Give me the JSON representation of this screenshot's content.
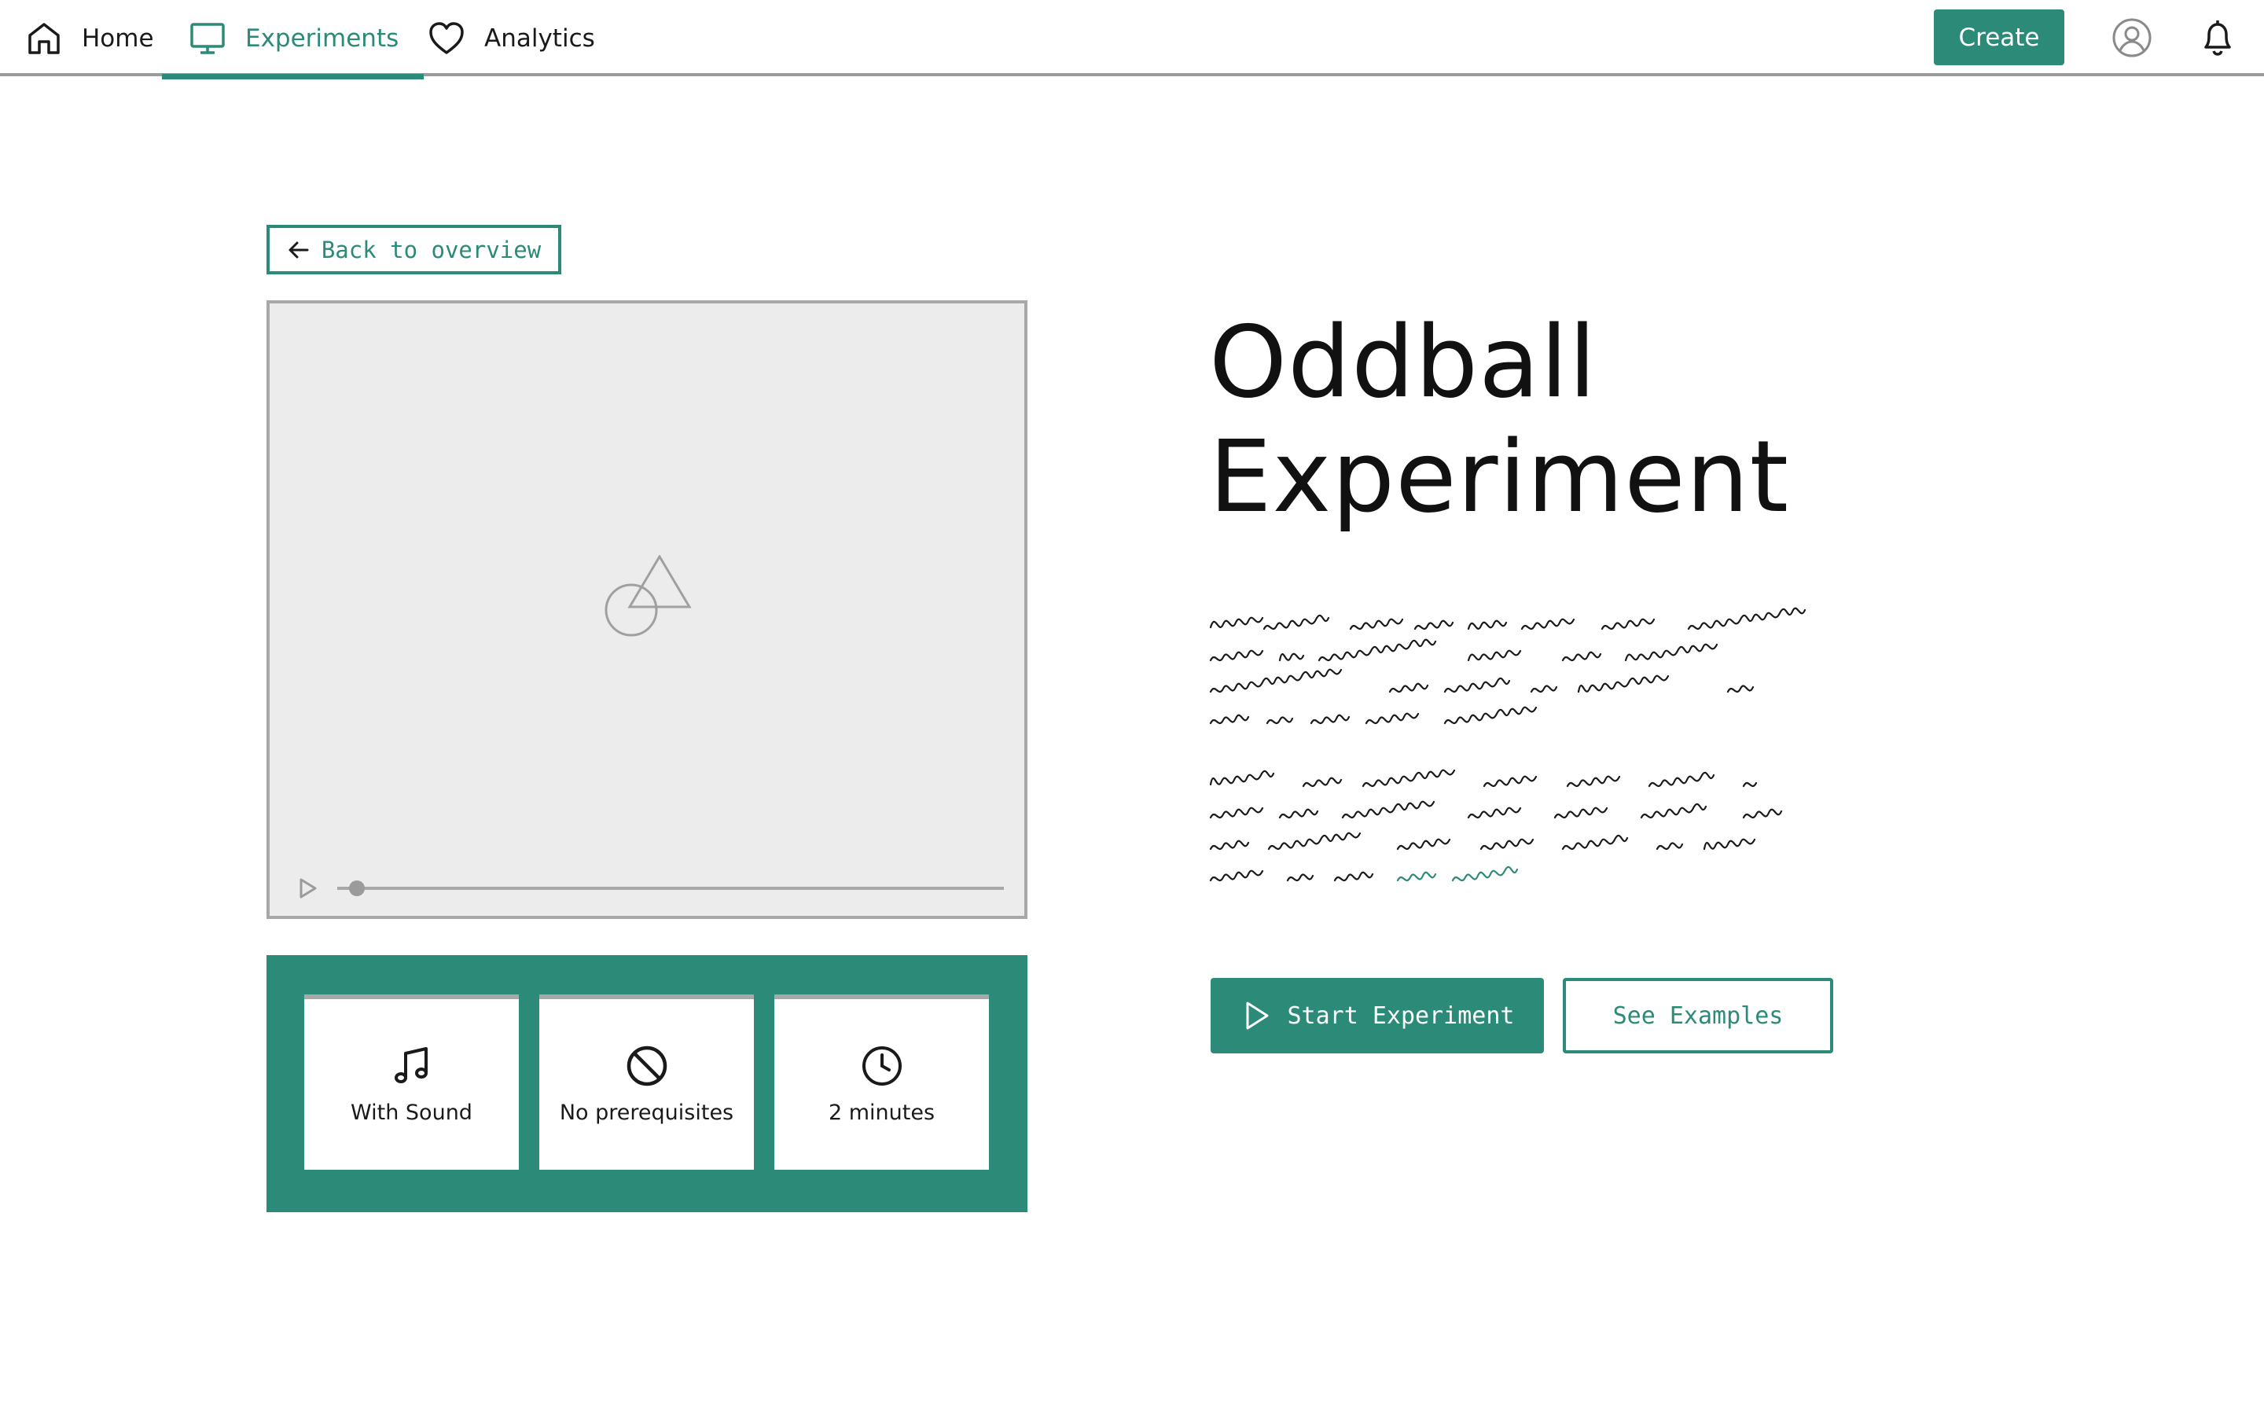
{
  "nav": {
    "items": [
      {
        "label": "Home",
        "icon": "home-icon"
      },
      {
        "label": "Experiments",
        "icon": "monitor-icon",
        "active": true
      },
      {
        "label": "Analytics",
        "icon": "heart-icon"
      }
    ],
    "create_label": "Create",
    "user_icon": "user-circle-icon",
    "bell_icon": "bell-icon"
  },
  "back": {
    "label": "Back to overview",
    "icon": "arrow-left-icon"
  },
  "media": {
    "placeholder_icon": "shapes-placeholder-icon",
    "play_icon": "play-icon",
    "progress": 0.03
  },
  "info": [
    {
      "label": "With Sound",
      "icon": "music-note-icon"
    },
    {
      "label": "No prerequisites",
      "icon": "prohibited-icon"
    },
    {
      "label": "2 minutes",
      "icon": "clock-icon"
    }
  ],
  "experiment": {
    "title_line1": "Oddball",
    "title_line2": "Experiment"
  },
  "actions": {
    "start_label": "Start Experiment",
    "examples_label": "See Examples"
  },
  "colors": {
    "accent": "#2b8a78",
    "placeholder_bg": "#ececec",
    "border_gray": "#a8a8a8",
    "text": "#1a1a1a"
  }
}
